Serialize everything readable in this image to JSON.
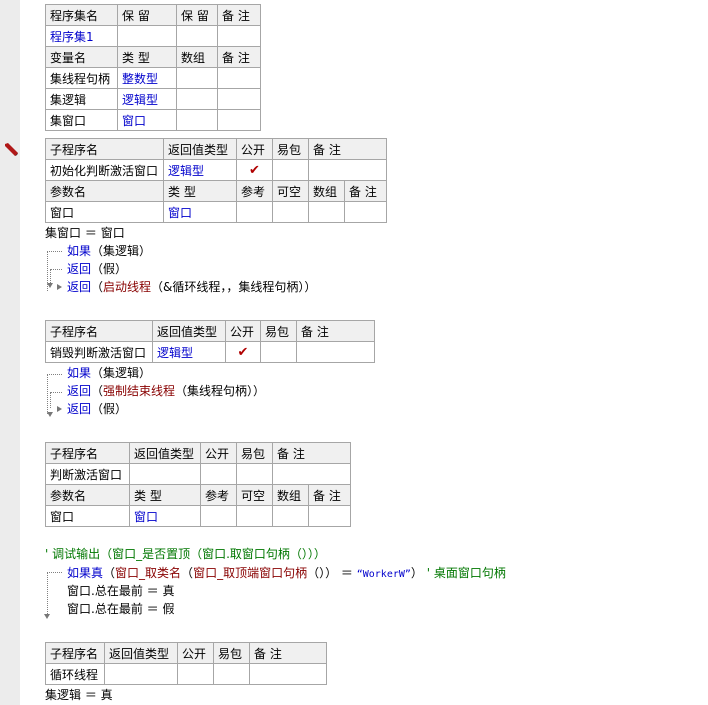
{
  "assembly_table": {
    "header": [
      "程序集名",
      "保 留",
      "保 留",
      "备 注"
    ],
    "row": [
      "程序集1",
      "",
      "",
      ""
    ],
    "var_header": [
      "变量名",
      "类 型",
      "数组",
      "备 注"
    ],
    "vars": [
      {
        "name": "集线程句柄",
        "type": "整数型",
        "array": "",
        "note": ""
      },
      {
        "name": "集逻辑",
        "type": "逻辑型",
        "array": "",
        "note": ""
      },
      {
        "name": "集窗口",
        "type": "窗口",
        "array": "",
        "note": ""
      }
    ]
  },
  "sub1": {
    "header": [
      "子程序名",
      "返回值类型",
      "公开",
      "易包",
      "备 注"
    ],
    "name": "初始化判断激活窗口",
    "ret": "逻辑型",
    "public_mark": "✔",
    "param_header": [
      "参数名",
      "类 型",
      "参考",
      "可空",
      "数组",
      "备 注"
    ],
    "param": {
      "name": "窗口",
      "type": "窗口"
    },
    "code": {
      "l1": {
        "a": "集窗口",
        "op": "＝",
        "b": "窗口"
      },
      "l2": {
        "kw": "如果",
        "arg": "（集逻辑）"
      },
      "l3": {
        "kw": "返回",
        "arg": "（假）"
      },
      "l4": {
        "kw": "返回",
        "open": "（",
        "fn": "启动线程",
        "arg": "（&循环线程，，集线程句柄））"
      }
    }
  },
  "sub2": {
    "header": [
      "子程序名",
      "返回值类型",
      "公开",
      "易包",
      "备 注"
    ],
    "name": "销毁判断激活窗口",
    "ret": "逻辑型",
    "public_mark": "✔",
    "code": {
      "l1": {
        "kw": "如果",
        "arg": "（集逻辑）"
      },
      "l2": {
        "kw": "返回",
        "open": "（",
        "fn": "强制结束线程",
        "arg": "（集线程句柄））"
      },
      "l3": {
        "kw": "返回",
        "arg": "（假）"
      }
    }
  },
  "sub3": {
    "header": [
      "子程序名",
      "返回值类型",
      "公开",
      "易包",
      "备 注"
    ],
    "name": "判断激活窗口",
    "param_header": [
      "参数名",
      "类 型",
      "参考",
      "可空",
      "数组",
      "备 注"
    ],
    "param": {
      "name": "窗口",
      "type": "窗口"
    },
    "code": {
      "comment": "' 调试输出（窗口_是否置顶（窗口.取窗口句柄（）））",
      "if_kw": "如果真",
      "if_p1": "（",
      "if_fn1": "窗口_取类名",
      "if_p2": "（",
      "if_fn2": "窗口_取顶端窗口句柄",
      "if_p3": "（）） ＝ ",
      "if_str": "“WorkerW”",
      "if_p4": "）",
      "if_comment": "' 桌面窗口句柄",
      "s1": "窗口.总在最前 ＝ 真",
      "s2": "窗口.总在最前 ＝ 假"
    }
  },
  "sub4": {
    "header": [
      "子程序名",
      "返回值类型",
      "公开",
      "易包",
      "备 注"
    ],
    "name": "循环线程",
    "code": {
      "l1": "集逻辑 ＝ 真"
    }
  }
}
